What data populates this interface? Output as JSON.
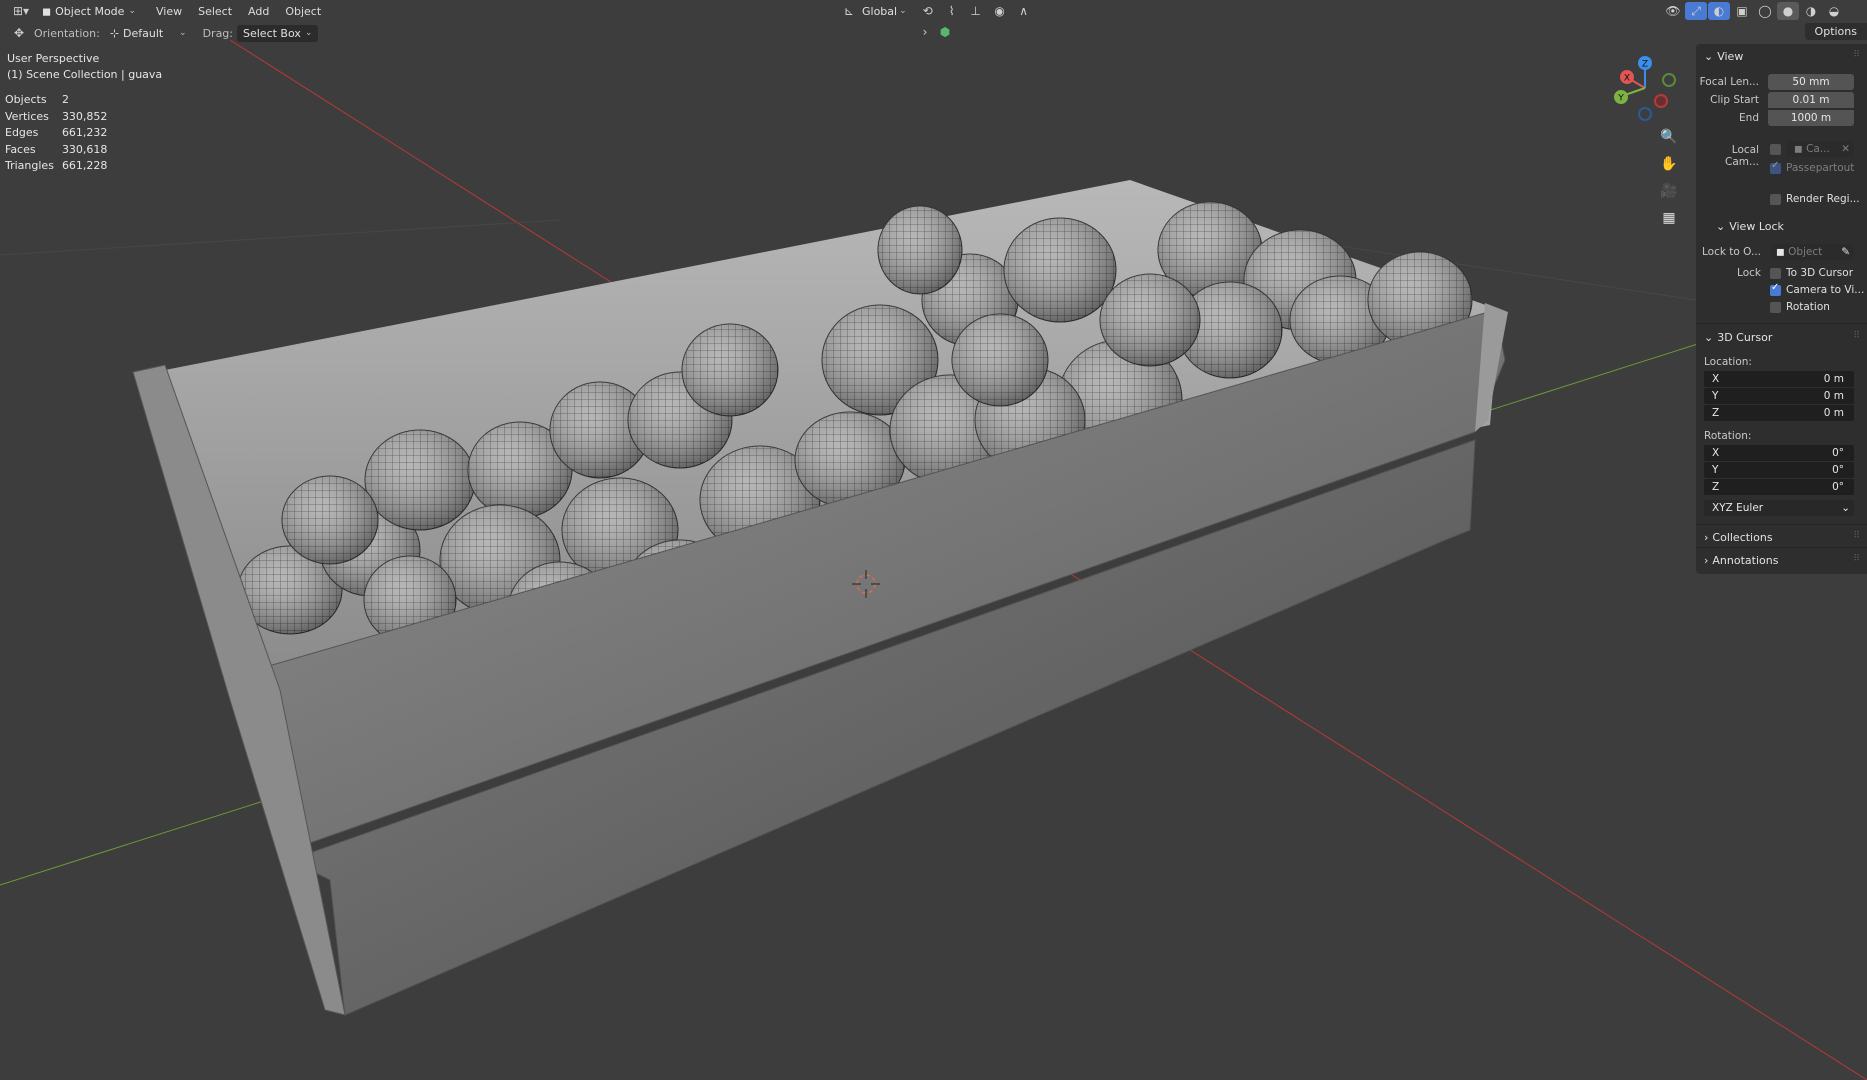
{
  "header": {
    "editor_type_icon": "cube-editor-icon",
    "mode": "Object Mode",
    "menus": [
      "View",
      "Select",
      "Add",
      "Object"
    ],
    "orientation_label": "Orientation:",
    "orientation_value": "Default",
    "drag_label": "Drag:",
    "drag_value": "Select Box",
    "transform_orientation": "Global",
    "options_label": "Options"
  },
  "overlay": {
    "view_name": "User Perspective",
    "collection": "(1) Scene Collection | guava",
    "stats": [
      {
        "label": "Objects",
        "value": "2"
      },
      {
        "label": "Vertices",
        "value": "330,852"
      },
      {
        "label": "Edges",
        "value": "661,232"
      },
      {
        "label": "Faces",
        "value": "330,618"
      },
      {
        "label": "Triangles",
        "value": "661,228"
      }
    ]
  },
  "gizmo": {
    "x": "X",
    "y": "Y",
    "z": "Z"
  },
  "panel": {
    "view": {
      "title": "View",
      "focal_label": "Focal Len...",
      "focal_value": "50 mm",
      "clip_start_label": "Clip Start",
      "clip_start_value": "0.01 m",
      "clip_end_label": "End",
      "clip_end_value": "1000 m",
      "local_camera_label": "Local Cam...",
      "local_camera_value": "Ca...",
      "passepartout_label": "Passepartout",
      "render_region_label": "Render Regi..."
    },
    "view_lock": {
      "title": "View Lock",
      "lock_to_label": "Lock to O...",
      "lock_to_placeholder": "Object",
      "lock_label": "Lock",
      "to_cursor_label": "To 3D Cursor",
      "camera_to_view_label": "Camera to Vi...",
      "rotation_label": "Rotation"
    },
    "cursor": {
      "title": "3D Cursor",
      "location_label": "Location:",
      "location": [
        {
          "axis": "X",
          "value": "0 m"
        },
        {
          "axis": "Y",
          "value": "0 m"
        },
        {
          "axis": "Z",
          "value": "0 m"
        }
      ],
      "rotation_label": "Rotation:",
      "rotation": [
        {
          "axis": "X",
          "value": "0°"
        },
        {
          "axis": "Y",
          "value": "0°"
        },
        {
          "axis": "Z",
          "value": "0°"
        }
      ],
      "rotation_mode": "XYZ Euler"
    },
    "collections_title": "Collections",
    "annotations_title": "Annotations"
  },
  "colors": {
    "background": "#3d3d3d",
    "panel": "#2e2e2e",
    "x_axis": "#e05555",
    "y_axis": "#7cb342",
    "z_axis": "#3b8eea",
    "checkbox_on": "#4a7bd4"
  }
}
